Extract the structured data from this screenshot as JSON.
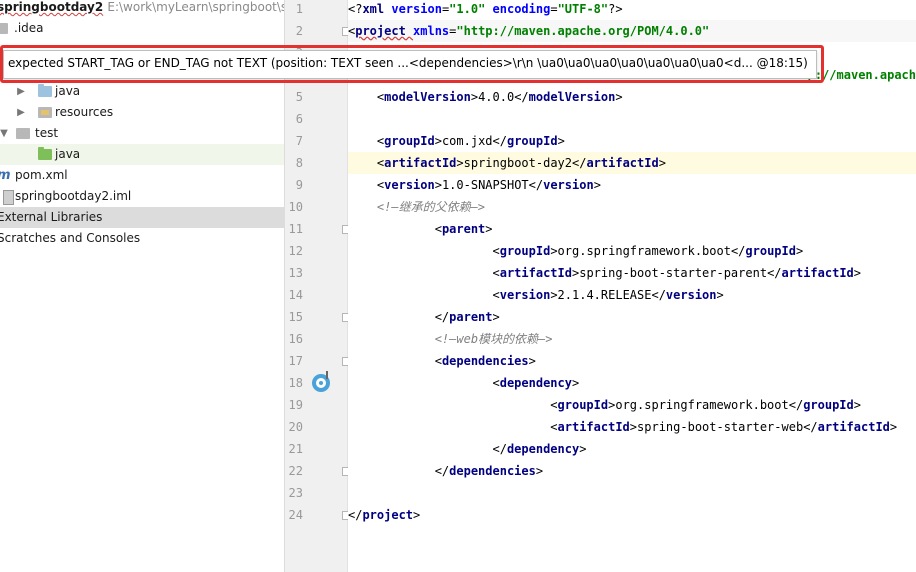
{
  "tree": {
    "project_name": "springbootday2",
    "project_path": "E:\\work\\myLearn\\springboot\\sp",
    "idea_label": ".idea",
    "java_main_label": "java",
    "resources_label": "resources",
    "test_label": "test",
    "java_test_label": "java",
    "pom_label": "pom.xml",
    "iml_label": "springbootday2.iml",
    "external_libraries_label": "External Libraries",
    "scratches_label": "Scratches and Consoles"
  },
  "editor": {
    "lines": [
      {
        "n": "1",
        "segs": [
          [
            "br",
            "<?"
          ],
          [
            "tg",
            "xml "
          ],
          [
            "at",
            "version"
          ],
          [
            "br",
            "="
          ],
          [
            "av",
            "\"1.0\" "
          ],
          [
            "at",
            "encoding"
          ],
          [
            "br",
            "="
          ],
          [
            "av",
            "\"UTF-8\""
          ],
          [
            "br",
            "?>"
          ]
        ]
      },
      {
        "n": "2",
        "segs": [
          [
            "br",
            "<"
          ],
          [
            "tg",
            "project "
          ],
          [
            "at",
            "xmlns"
          ],
          [
            "br",
            "="
          ],
          [
            "av",
            "\"http://maven.apache.org/POM/4.0.0\""
          ]
        ]
      },
      {
        "n": "3",
        "segs": []
      },
      {
        "n": "4",
        "segs": []
      },
      {
        "n": "5",
        "segs": [
          [
            "tx",
            "    "
          ],
          [
            "br",
            "<"
          ],
          [
            "tg",
            "modelVersion"
          ],
          [
            "br",
            ">"
          ],
          [
            "tx",
            "4.0.0"
          ],
          [
            "br",
            "</"
          ],
          [
            "tg",
            "modelVersion"
          ],
          [
            "br",
            ">"
          ]
        ]
      },
      {
        "n": "6",
        "segs": []
      },
      {
        "n": "7",
        "segs": [
          [
            "tx",
            "    "
          ],
          [
            "br",
            "<"
          ],
          [
            "tg",
            "groupId"
          ],
          [
            "br",
            ">"
          ],
          [
            "tx",
            "com.jxd"
          ],
          [
            "br",
            "</"
          ],
          [
            "tg",
            "groupId"
          ],
          [
            "br",
            ">"
          ]
        ]
      },
      {
        "n": "8",
        "segs": [
          [
            "tx",
            "    "
          ],
          [
            "br",
            "<"
          ],
          [
            "tg",
            "artifactId"
          ],
          [
            "br",
            ">"
          ],
          [
            "tx",
            "springboot-day2"
          ],
          [
            "br",
            "</"
          ],
          [
            "tg",
            "artifactId"
          ],
          [
            "br",
            ">"
          ]
        ]
      },
      {
        "n": "9",
        "segs": [
          [
            "tx",
            "    "
          ],
          [
            "br",
            "<"
          ],
          [
            "tg",
            "version"
          ],
          [
            "br",
            ">"
          ],
          [
            "tx",
            "1.0-SNAPSHOT"
          ],
          [
            "br",
            "</"
          ],
          [
            "tg",
            "version"
          ],
          [
            "br",
            ">"
          ]
        ]
      },
      {
        "n": "10",
        "segs": [
          [
            "tx",
            "    "
          ],
          [
            "cm",
            "<!—继承的父依赖—>"
          ]
        ]
      },
      {
        "n": "11",
        "segs": [
          [
            "tx",
            "            "
          ],
          [
            "br",
            "<"
          ],
          [
            "tg",
            "parent"
          ],
          [
            "br",
            ">"
          ]
        ]
      },
      {
        "n": "12",
        "segs": [
          [
            "tx",
            "                    "
          ],
          [
            "br",
            "<"
          ],
          [
            "tg",
            "groupId"
          ],
          [
            "br",
            ">"
          ],
          [
            "tx",
            "org.springframework.boot"
          ],
          [
            "br",
            "</"
          ],
          [
            "tg",
            "groupId"
          ],
          [
            "br",
            ">"
          ]
        ]
      },
      {
        "n": "13",
        "segs": [
          [
            "tx",
            "                    "
          ],
          [
            "br",
            "<"
          ],
          [
            "tg",
            "artifactId"
          ],
          [
            "br",
            ">"
          ],
          [
            "tx",
            "spring-boot-starter-parent"
          ],
          [
            "br",
            "</"
          ],
          [
            "tg",
            "artifactId"
          ],
          [
            "br",
            ">"
          ]
        ]
      },
      {
        "n": "14",
        "segs": [
          [
            "tx",
            "                    "
          ],
          [
            "br",
            "<"
          ],
          [
            "tg",
            "version"
          ],
          [
            "br",
            ">"
          ],
          [
            "tx",
            "2.1.4.RELEASE"
          ],
          [
            "br",
            "</"
          ],
          [
            "tg",
            "version"
          ],
          [
            "br",
            ">"
          ]
        ]
      },
      {
        "n": "15",
        "segs": [
          [
            "tx",
            "            "
          ],
          [
            "br",
            "</"
          ],
          [
            "tg",
            "parent"
          ],
          [
            "br",
            ">"
          ]
        ]
      },
      {
        "n": "16",
        "segs": [
          [
            "tx",
            "            "
          ],
          [
            "cm",
            "<!—web模块的依赖—>"
          ]
        ]
      },
      {
        "n": "17",
        "segs": [
          [
            "tx",
            "            "
          ],
          [
            "br",
            "<"
          ],
          [
            "tg",
            "dependencies"
          ],
          [
            "br",
            ">"
          ]
        ]
      },
      {
        "n": "18",
        "segs": [
          [
            "tx",
            "                    "
          ],
          [
            "br",
            "<"
          ],
          [
            "tg",
            "dependency"
          ],
          [
            "br",
            ">"
          ]
        ]
      },
      {
        "n": "19",
        "segs": [
          [
            "tx",
            "                            "
          ],
          [
            "br",
            "<"
          ],
          [
            "tg",
            "groupId"
          ],
          [
            "br",
            ">"
          ],
          [
            "tx",
            "org.springframework.boot"
          ],
          [
            "br",
            "</"
          ],
          [
            "tg",
            "groupId"
          ],
          [
            "br",
            ">"
          ]
        ]
      },
      {
        "n": "20",
        "segs": [
          [
            "tx",
            "                            "
          ],
          [
            "br",
            "<"
          ],
          [
            "tg",
            "artifactId"
          ],
          [
            "br",
            ">"
          ],
          [
            "tx",
            "spring-boot-starter-web"
          ],
          [
            "br",
            "</"
          ],
          [
            "tg",
            "artifactId"
          ],
          [
            "br",
            ">"
          ]
        ]
      },
      {
        "n": "21",
        "segs": [
          [
            "tx",
            "                    "
          ],
          [
            "br",
            "</"
          ],
          [
            "tg",
            "dependency"
          ],
          [
            "br",
            ">"
          ]
        ]
      },
      {
        "n": "22",
        "segs": [
          [
            "tx",
            "            "
          ],
          [
            "br",
            "</"
          ],
          [
            "tg",
            "dependencies"
          ],
          [
            "br",
            ">"
          ]
        ]
      },
      {
        "n": "23",
        "segs": []
      },
      {
        "n": "24",
        "segs": [
          [
            "br",
            "</"
          ],
          [
            "tg",
            "project"
          ],
          [
            "br",
            ">"
          ]
        ]
      }
    ],
    "line3_tail": "p://maven.apach",
    "current_line": "8"
  },
  "tooltip": {
    "text": "expected START_TAG or END_TAG not TEXT (position: TEXT seen ...<dependencies>\\r\\n \\ua0\\ua0\\ua0\\ua0\\ua0\\ua0\\ua0<d... @18:15)"
  },
  "colors": {
    "tag": "#000080",
    "attr": "#0000ff",
    "value": "#008000",
    "comment": "#808080",
    "highlight_box": "#e53030",
    "current_line": "#fffbe1"
  }
}
